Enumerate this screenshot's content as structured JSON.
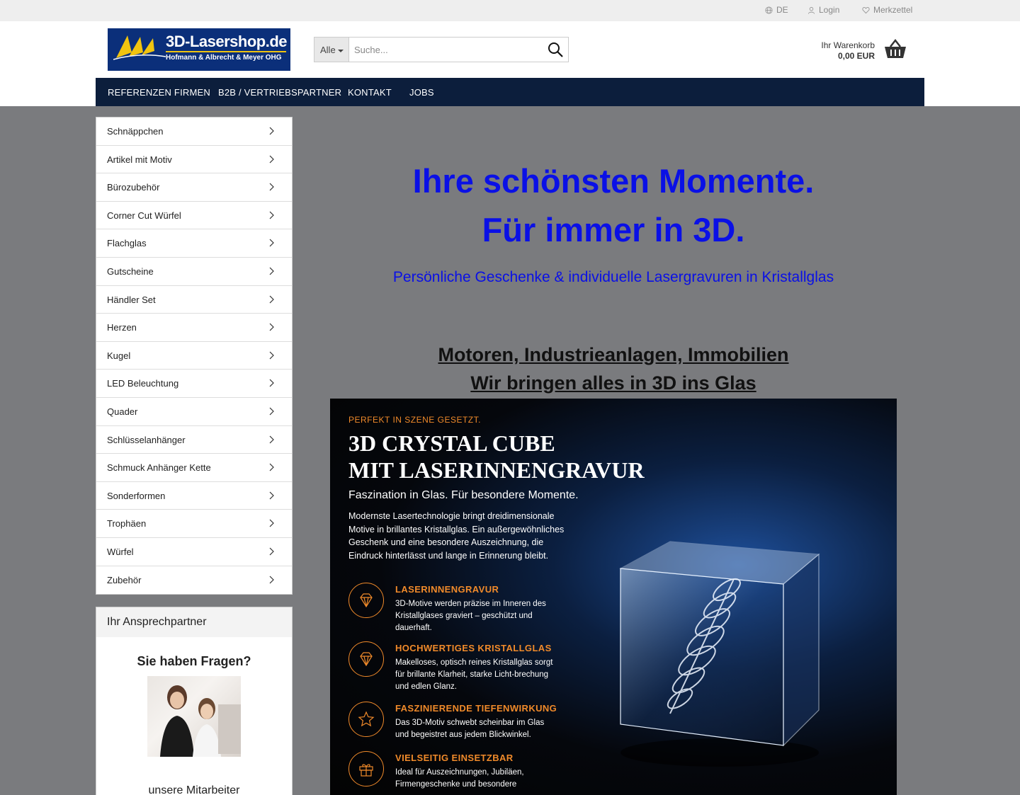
{
  "topbar": {
    "language": "DE",
    "login": "Login",
    "wishlist": "Merkzettel"
  },
  "header": {
    "logo_text": "3D-Lasershop.de",
    "logo_sub": "Hofmann & Albrecht & Meyer OHG",
    "search_category": "Alle",
    "search_placeholder": "Suche...",
    "cart_label": "Ihr Warenkorb",
    "cart_total": "0,00 EUR"
  },
  "nav": {
    "items": [
      "REFERENZEN FIRMEN",
      "B2B / VERTRIEBSPARTNER",
      "KONTAKT",
      "JOBS"
    ]
  },
  "categories": [
    "Schnäppchen",
    "Artikel mit Motiv",
    "Bürozubehör",
    "Corner Cut Würfel",
    "Flachglas",
    "Gutscheine",
    "Händler Set",
    "Herzen",
    "Kugel",
    "LED Beleuchtung",
    "Quader",
    "Schlüsselanhänger",
    "Schmuck Anhänger Kette",
    "Sonderformen",
    "Trophäen",
    "Würfel",
    "Zubehör"
  ],
  "contact": {
    "heading": "Ihr Ansprechpartner",
    "question": "Sie haben Fragen?",
    "staff": "unsere Mitarbeiter"
  },
  "hero": {
    "line1": "Ihre schönsten Momente.",
    "line2": "Für immer in 3D.",
    "subtitle": "Persönliche Geschenke & individuelle Lasergravuren in Kristallglas",
    "motor_line1": "Motoren, Industrieanlagen, Immobilien",
    "motor_line2": "Wir bringen alles in 3D ins Glas"
  },
  "banner": {
    "kicker": "PERFEKT IN SZENE GESETZT.",
    "title1": "3D CRYSTAL CUBE",
    "title2": "MIT LASERINNENGRAVUR",
    "tagline": "Faszination in Glas. Für besondere Momente.",
    "body": "Modernste Lasertechnologie bringt dreidimensionale Motive in brillantes Kristallglas. Ein außergewöhnliches Geschenk und eine besondere Auszeichnung, die Eindruck hinterlässt und lange in Erinnerung bleibt.",
    "features": [
      {
        "title": "LASERINNENGRAVUR",
        "text": "3D-Motive werden präzise im Inneren des Kristallglases graviert – geschützt und dauerhaft.",
        "icon": "diamond-icon"
      },
      {
        "title": "HOCHWERTIGES KRISTALLGLAS",
        "text": "Makelloses, optisch reines Kristallglas sorgt für brillante Klarheit, starke Licht-brechung und edlen Glanz.",
        "icon": "diamond-icon"
      },
      {
        "title": "FASZINIERENDE TIEFENWIRKUNG",
        "text": "Das 3D-Motiv schwebt scheinbar im Glas und begeistret aus jedem Blickwinkel.",
        "icon": "star-icon"
      },
      {
        "title": "VIELSEITIG EINSETZBAR",
        "text": "Ideal für Auszeichnungen, Jubiläen, Firmengeschenke und besondere",
        "icon": "gift-icon"
      }
    ]
  },
  "colors": {
    "nav_bg": "#0c1e3c",
    "main_bg": "#7a7b7e",
    "hero_blue": "#0a10e6",
    "accent_orange": "#f08a2a"
  }
}
